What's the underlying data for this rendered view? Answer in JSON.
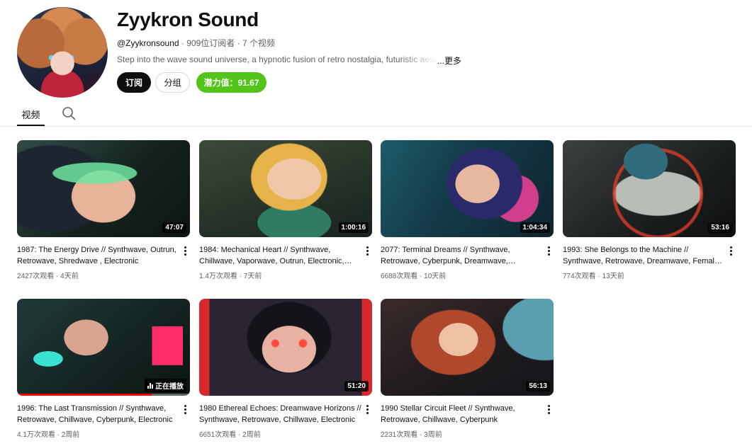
{
  "channel": {
    "name": "Zyykron Sound",
    "handle": "@Zyykronsound",
    "subscribers": "909位订阅者",
    "video_count": "7 个视频",
    "separator": " · ",
    "description": "Step into the wave sound universe, a hypnotic fusion of retro nostalgia, futuristic aesthetics",
    "more_label": "...更多"
  },
  "buttons": {
    "subscribe": "订阅",
    "group": "分组",
    "potential": "潜力值：91.67"
  },
  "tabs": {
    "videos": "视频",
    "search_icon": "search-icon"
  },
  "colors": {
    "accent_green": "#52c41a",
    "subscribe_bg": "#0f0f0f",
    "progress_red": "#ff0000"
  },
  "videos": [
    {
      "title": "1987: The Energy Drive // Synthwave, Outrun, Retrowave, Shredwave , Electronic",
      "duration": "47:07",
      "views": "2427次观看",
      "age": "4天前"
    },
    {
      "title": "1984: Mechanical Heart // Synthwave, Chillwave, Vaporwave, Outrun, Electronic, Retrowave",
      "duration": "1:00:16",
      "views": "1.4万次观看",
      "age": "7天前"
    },
    {
      "title": "2077: Terminal Dreams // Synthwave, Retrowave, Cyberpunk, Dreamwave, Electronic",
      "duration": "1:04:34",
      "views": "6688次观看",
      "age": "10天前"
    },
    {
      "title": "1993: She Belongs to the Machine // Synthwave, Retrowave, Dreamwave, Female Vocals",
      "duration": "53:16",
      "views": "774次观看",
      "age": "13天前"
    },
    {
      "title": "1996: The Last Transmission // Synthwave, Retrowave, Chillwave, Cyberpunk, Electronic",
      "status": "正在播放",
      "progress": 0.78,
      "views": "4.1万次观看",
      "age": "2周前"
    },
    {
      "title": "1980 Ethereal Echoes: Dreamwave Horizons // Synthwave, Retrowave, Chillwave, Electronic",
      "duration": "51:20",
      "views": "6651次观看",
      "age": "2周前"
    },
    {
      "title": "1990 Stellar Circuit Fleet // Synthwave, Retrowave, Chillwave, Cyberpunk",
      "duration": "56:13",
      "views": "2231次观看",
      "age": "3周前"
    }
  ]
}
